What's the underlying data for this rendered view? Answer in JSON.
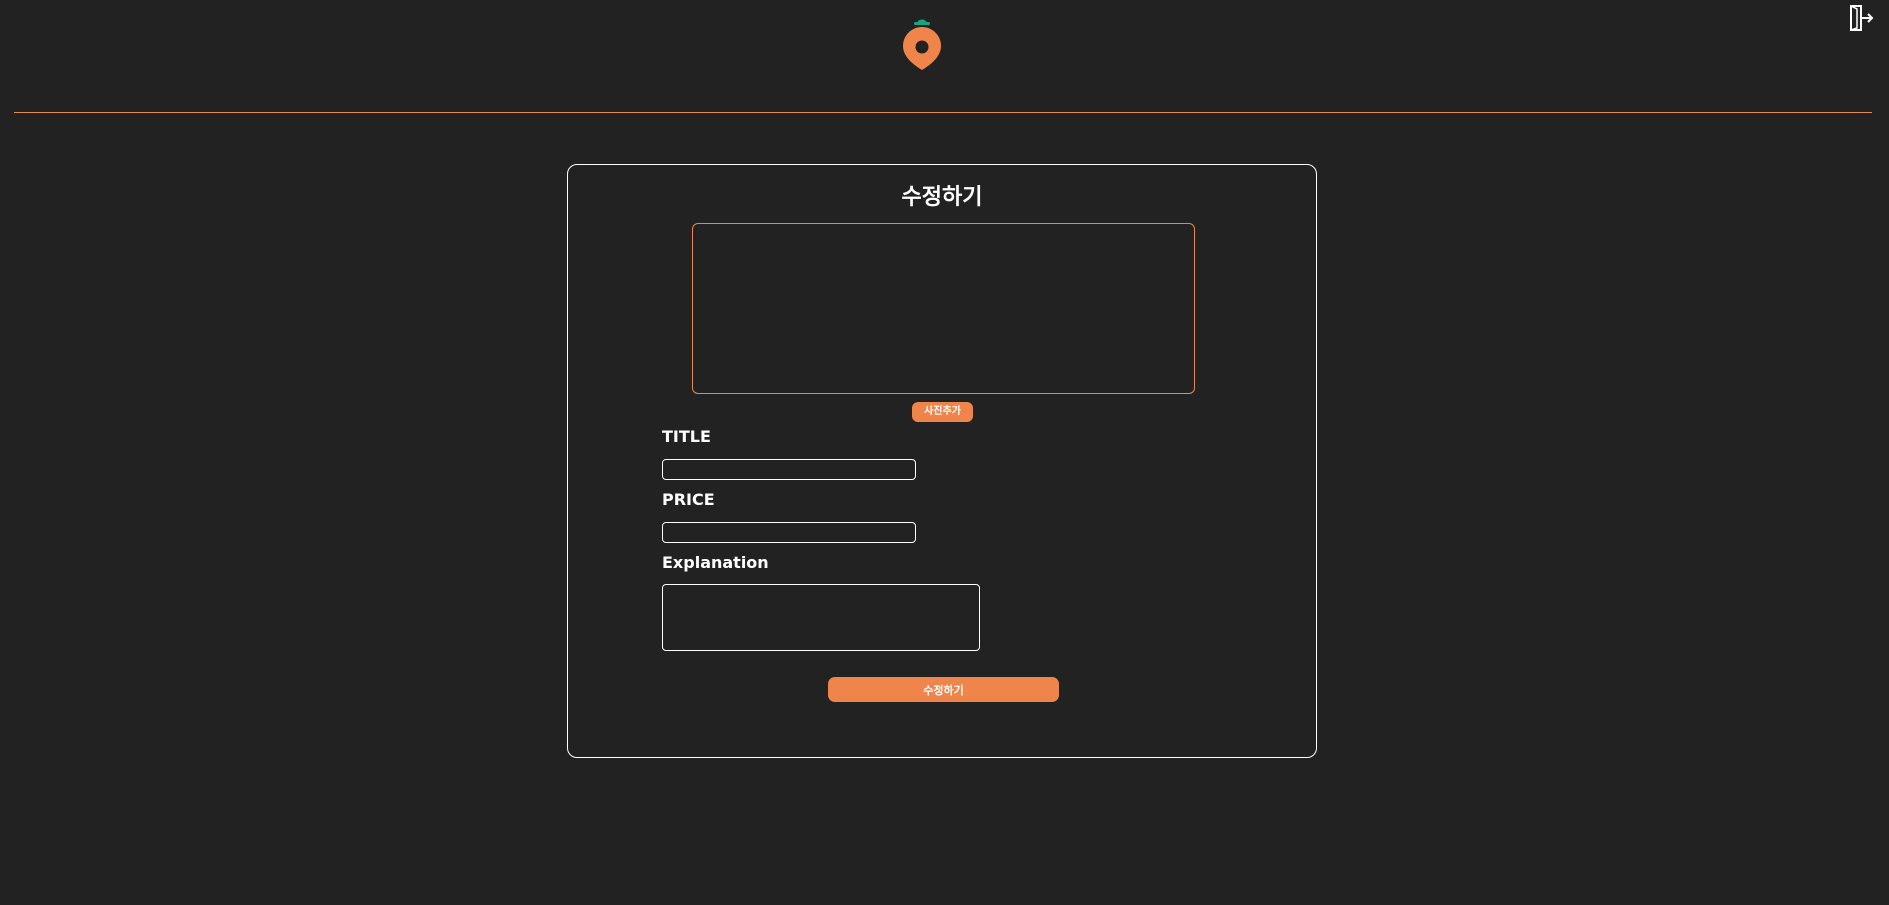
{
  "form": {
    "title": "수정하기",
    "add_photo_label": "사진추가",
    "title_label": "TITLE",
    "title_value": "",
    "price_label": "PRICE",
    "price_value": "",
    "explanation_label": "Explanation",
    "explanation_value": "",
    "submit_label": "수정하기"
  },
  "icons": {
    "logo": "carrot-icon",
    "logout": "logout-icon"
  },
  "colors": {
    "background": "#222222",
    "accent": "#ef854a",
    "divider": "#e58a4f",
    "logo_leaf": "#1aa37c"
  }
}
